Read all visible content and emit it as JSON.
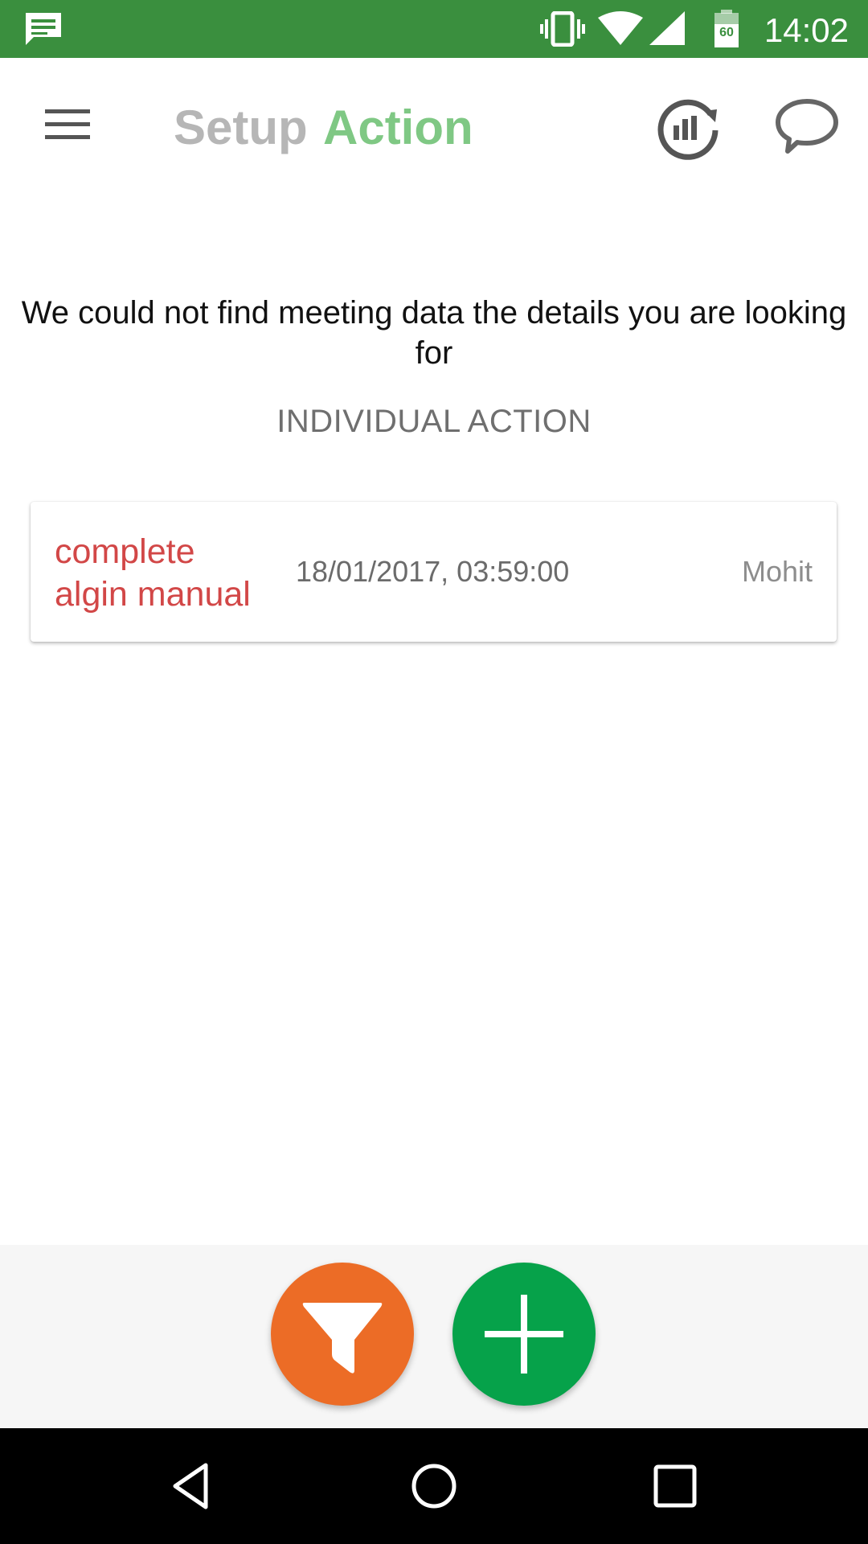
{
  "status_bar": {
    "time": "14:02",
    "battery_level": "60",
    "icons": [
      "message-icon",
      "vibrate-icon",
      "wifi-icon",
      "signal-icon",
      "battery-icon"
    ]
  },
  "app_bar": {
    "tabs": [
      {
        "label": "Setup",
        "selected": false
      },
      {
        "label": "Action",
        "selected": true
      }
    ],
    "icons": [
      "menu-icon",
      "chart-refresh-icon",
      "chat-icon"
    ]
  },
  "main": {
    "empty_message": "We could not find meeting data the details you are looking for",
    "section_title": "INDIVIDUAL ACTION",
    "actions": [
      {
        "title": "complete algin manual",
        "datetime": "18/01/2017, 03:59:00",
        "owner": "Mohit"
      }
    ]
  },
  "fabs": [
    "filter-icon",
    "plus-icon"
  ],
  "nav_bar": [
    "back-icon",
    "home-icon",
    "recents-icon"
  ],
  "colors": {
    "status_bar": "#3a8f3e",
    "tab_active": "#7fc884",
    "tab_inactive": "#b6b6b6",
    "action_title": "#d24747",
    "fab_filter": "#ec6c26",
    "fab_add": "#06a24a"
  }
}
